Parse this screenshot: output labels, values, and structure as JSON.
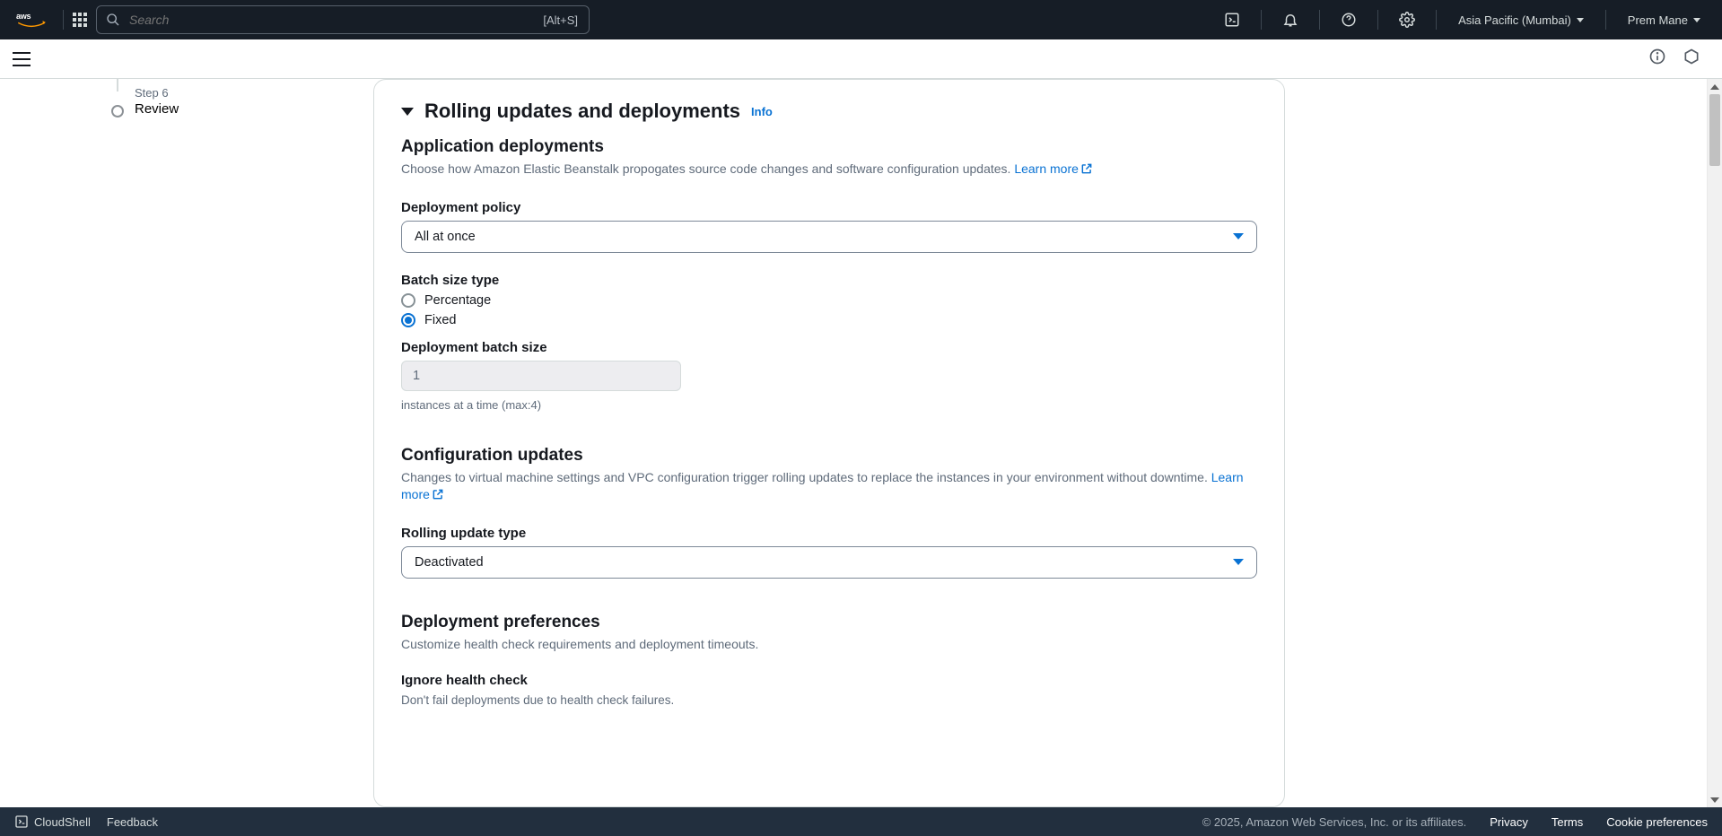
{
  "topnav": {
    "logo_text": "aws",
    "search_placeholder": "Search",
    "search_shortcut": "[Alt+S]",
    "region": "Asia Pacific (Mumbai)",
    "user": "Prem Mane"
  },
  "sidebar": {
    "step_label": "Step 6",
    "step_title": "Review"
  },
  "panel": {
    "header": "Rolling updates and deployments",
    "info_link": "Info",
    "app_deploy": {
      "title": "Application deployments",
      "desc_prefix": "Choose how Amazon Elastic Beanstalk propogates source code changes and software configuration updates. ",
      "learn_more": "Learn more"
    },
    "policy": {
      "label": "Deployment policy",
      "value": "All at once"
    },
    "batch_type": {
      "label": "Batch size type",
      "opt_percentage": "Percentage",
      "opt_fixed": "Fixed"
    },
    "batch_size": {
      "label": "Deployment batch size",
      "value": "1",
      "hint": "instances at a time (max:4)"
    },
    "config_updates": {
      "title": "Configuration updates",
      "desc_prefix": "Changes to virtual machine settings and VPC configuration trigger rolling updates to replace the instances in your environment without downtime. ",
      "learn_more": "Learn more"
    },
    "rolling_type": {
      "label": "Rolling update type",
      "value": "Deactivated"
    },
    "deploy_prefs": {
      "title": "Deployment preferences",
      "desc": "Customize health check requirements and deployment timeouts."
    },
    "ignore_health": {
      "label": "Ignore health check",
      "desc": "Don't fail deployments due to health check failures."
    }
  },
  "footer": {
    "cloudshell": "CloudShell",
    "feedback": "Feedback",
    "copyright": "© 2025, Amazon Web Services, Inc. or its affiliates.",
    "privacy": "Privacy",
    "terms": "Terms",
    "cookies": "Cookie preferences"
  }
}
